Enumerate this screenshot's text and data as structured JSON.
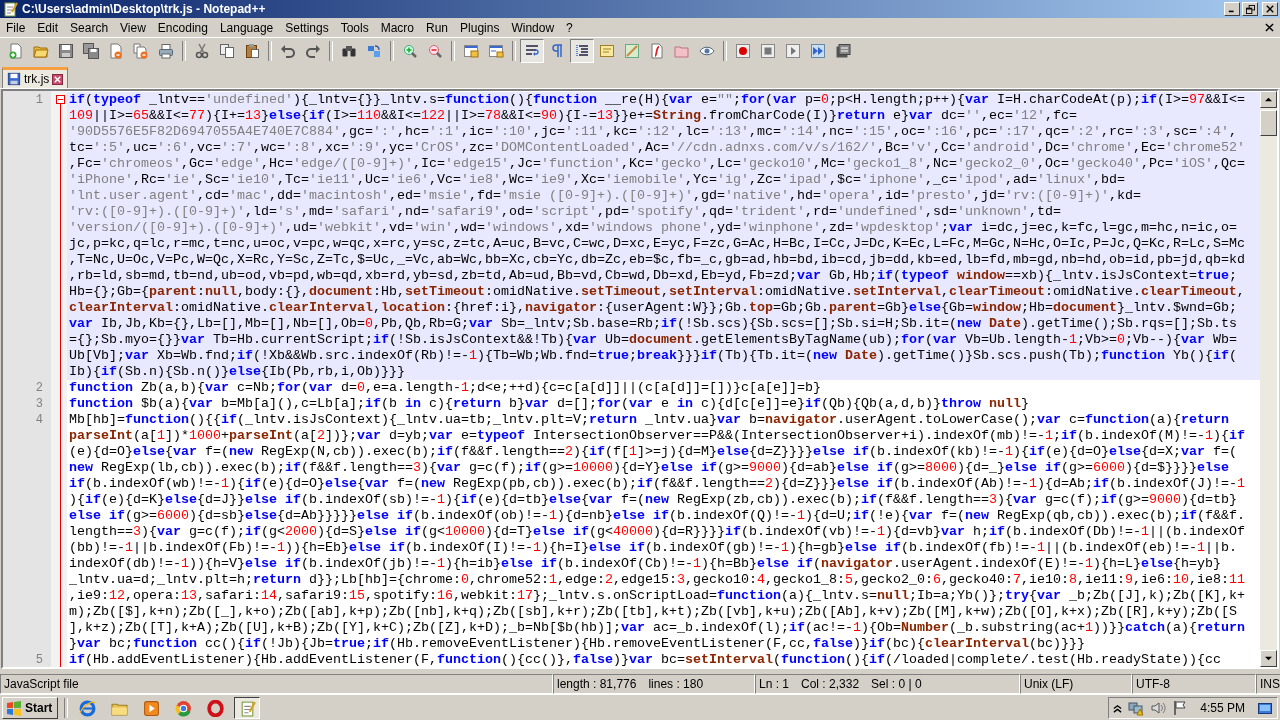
{
  "window": {
    "title": "C:\\Users\\admin\\Desktop\\trk.js - Notepad++"
  },
  "menu": [
    "File",
    "Edit",
    "Search",
    "View",
    "Encoding",
    "Language",
    "Settings",
    "Tools",
    "Macro",
    "Run",
    "Plugins",
    "Window",
    "?"
  ],
  "toolbar": {
    "word_wrap": true,
    "show_all_characters": false,
    "indent_guide": true
  },
  "tabs": [
    {
      "label": "trk.js",
      "selected": true
    }
  ],
  "editor": {
    "lines": [
      {
        "number": "1",
        "current": true,
        "foldable": true,
        "rows": [
          "if(typeof _lntv=='undefined'){_lntv={}}_lntv.s=function(){function __re(H){var e=\"\";for(var p=0;p<H.length;p++){var I=H.charCodeAt(p);if(I>=97&&I<=",
          "109||I>=65&&I<=77){I+=13}else{if(I>=110&&I<=122||I>=78&&I<=90){I-=13}}e+=String.fromCharCode(I)}return e}var dc='',ec='12',fc=",
          "'90D5576E5F82D6947055A4E740E7C884',gc=':',hc=':1',ic=':10',jc=':11',kc=':12',lc=':13',mc=':14',nc=':15',oc=':16',pc=':17',qc=':2',rc=':3',sc=':4',",
          "tc=':5',uc=':6',vc=':7',wc=':8',xc=':9',yc='CrOS',zc='DOMContentLoaded',Ac='//cdn.adnxs.com/v/s/162/',Bc='v',Cc='android',Dc='chrome',Ec='chrome52'",
          ",Fc='chromeos',Gc='edge',Hc='edge/([0-9]+)',Ic='edge15',Jc='function',Kc='gecko',Lc='gecko10',Mc='gecko1_8',Nc='gecko2_0',Oc='gecko40',Pc='iOS',Qc=",
          "'iPhone',Rc='ie',Sc='ie10',Tc='ie11',Uc='ie6',Vc='ie8',Wc='ie9',Xc='iemobile',Yc='ig',Zc='ipad',$c='iphone',_c='ipod',ad='linux',bd=",
          "'lnt.user.agent',cd='mac',dd='macintosh',ed='msie',fd='msie ([0-9]+).([0-9]+)',gd='native',hd='opera',id='presto',jd='rv:([0-9]+)',kd=",
          "'rv:([0-9]+).([0-9]+)',ld='s',md='safari',nd='safari9',od='script',pd='spotify',qd='trident',rd='undefined',sd='unknown',td=",
          "'version/([0-9]+).([0-9]+)',ud='webkit',vd='win',wd='windows',xd='windows phone',yd='winphone',zd='wpdesktop';var i=dc,j=ec,k=fc,l=gc,m=hc,n=ic,o=",
          "jc,p=kc,q=lc,r=mc,t=nc,u=oc,v=pc,w=qc,x=rc,y=sc,z=tc,A=uc,B=vc,C=wc,D=xc,E=yc,F=zc,G=Ac,H=Bc,I=Cc,J=Dc,K=Ec,L=Fc,M=Gc,N=Hc,O=Ic,P=Jc,Q=Kc,R=Lc,S=Mc",
          ",T=Nc,U=Oc,V=Pc,W=Qc,X=Rc,Y=Sc,Z=Tc,$=Uc,_=Vc,ab=Wc,bb=Xc,cb=Yc,db=Zc,eb=$c,fb=_c,gb=ad,hb=bd,ib=cd,jb=dd,kb=ed,lb=fd,mb=gd,nb=hd,ob=id,pb=jd,qb=kd",
          ",rb=ld,sb=md,tb=nd,ub=od,vb=pd,wb=qd,xb=rd,yb=sd,zb=td,Ab=ud,Bb=vd,Cb=wd,Db=xd,Eb=yd,Fb=zd;var Gb,Hb;if(typeof window==xb){_lntv.isJsContext=true;",
          "Hb={};Gb={parent:null,body:{},document:Hb,setTimeout:omidNative.setTimeout,setInterval:omidNative.setInterval,clearTimeout:omidNative.clearTimeout,",
          "clearInterval:omidNative.clearInterval,location:{href:i},navigator:{userAgent:W}};Gb.top=Gb;Gb.parent=Gb}else{Gb=window;Hb=document}_lntv.$wnd=Gb;",
          "var Ib,Jb,Kb={},Lb=[],Mb=[],Nb=[],Ob=0,Pb,Qb,Rb=G;var Sb=_lntv;Sb.base=Rb;if(!Sb.scs){Sb.scs=[];Sb.si=H;Sb.it=(new Date).getTime();Sb.rqs=[];Sb.ts",
          "={};Sb.myo={}}var Tb=Hb.currentScript;if(!Sb.isJsContext&&!Tb){var Ub=document.getElementsByTagName(ub);for(var Vb=Ub.length-1;Vb>=0;Vb--){var Wb=",
          "Ub[Vb];var Xb=Wb.fnd;if(!Xb&&Wb.src.indexOf(Rb)!=-1){Tb=Wb;Wb.fnd=true;break}}}if(Tb){Tb.it=(new Date).getTime()}Sb.scs.push(Tb);function Yb(){if(",
          "Ib){if(Sb.n){Sb.n()}else{Ib(Pb,rb,i,Ob)}}}"
        ]
      },
      {
        "number": "2",
        "current": false,
        "foldable": false,
        "rows": [
          "function Zb(a,b){var c=Nb;for(var d=0,e=a.length-1;d<e;++d){c=c[a[d]]||(c[a[d]]=[])}c[a[e]]=b}"
        ]
      },
      {
        "number": "3",
        "current": false,
        "foldable": false,
        "rows": [
          "function $b(a){var b=Mb[a](),c=Lb[a];if(b in c){return b}var d=[];for(var e in c){d[c[e]]=e}if(Qb){Qb(a,d,b)}throw null}"
        ]
      },
      {
        "number": "4",
        "current": false,
        "foldable": false,
        "rows": [
          "Mb[hb]=function(){{if(_lntv.isJsContext){_lntv.ua=tb;_lntv.plt=V;return _lntv.ua}var b=navigator.userAgent.toLowerCase();var c=function(a){return",
          "parseInt(a[1])*1000+parseInt(a[2])};var d=yb;var e=typeof IntersectionObserver==P&&(IntersectionObserver+i).indexOf(mb)!=-1;if(b.indexOf(M)!=-1){if",
          "(e){d=O}else{var f=(new RegExp(N,cb)).exec(b);if(f&&f.length==2){if(f[1]>=j){d=M}else{d=Z}}}}else if(b.indexOf(kb)!=-1){if(e){d=O}else{d=X;var f=(",
          "new RegExp(lb,cb)).exec(b);if(f&&f.length==3){var g=c(f);if(g>=10000){d=Y}else if(g>=9000){d=ab}else if(g>=8000){d=_}else if(g>=6000){d=$}}}}else",
          "if(b.indexOf(wb)!=-1){if(e){d=O}else{var f=(new RegExp(pb,cb)).exec(b);if(f&&f.length==2){d=Z}}}else if(b.indexOf(Ab)!=-1){d=Ab;if(b.indexOf(J)!=-1",
          "){if(e){d=K}else{d=J}}else if(b.indexOf(sb)!=-1){if(e){d=tb}else{var f=(new RegExp(zb,cb)).exec(b);if(f&&f.length==3){var g=c(f);if(g>=9000){d=tb}",
          "else if(g>=6000){d=sb}else{d=Ab}}}}}else if(b.indexOf(ob)!=-1){d=nb}else if(b.indexOf(Q)!=-1){d=U;if(!e){var f=(new RegExp(qb,cb)).exec(b);if(f&&f.",
          "length==3){var g=c(f);if(g<2000){d=S}else if(g<10000){d=T}else if(g<40000){d=R}}}}if(b.indexOf(vb)!=-1){d=vb}var h;if(b.indexOf(Db)!=-1||(b.indexOf",
          "(bb)!=-1||b.indexOf(Fb)!=-1)){h=Eb}else if(b.indexOf(I)!=-1){h=I}else if(b.indexOf(gb)!=-1){h=gb}else if(b.indexOf(fb)!=-1||(b.indexOf(eb)!=-1||b.",
          "indexOf(db)!=-1)){h=V}else if(b.indexOf(jb)!=-1){h=ib}else if(b.indexOf(Cb)!=-1){h=Bb}else if(navigator.userAgent.indexOf(E)!=-1){h=L}else{h=yb}",
          "_lntv.ua=d;_lntv.plt=h;return d}};Lb[hb]={chrome:0,chrome52:1,edge:2,edge15:3,gecko10:4,gecko1_8:5,gecko2_0:6,gecko40:7,ie10:8,ie11:9,ie6:10,ie8:11",
          ",ie9:12,opera:13,safari:14,safari9:15,spotify:16,webkit:17};_lntv.s.onScriptLoad=function(a){_lntv.s=null;Ib=a;Yb()};try{var _b;Zb([J],k);Zb([K],k+",
          "m);Zb([$],k+n);Zb([_],k+o);Zb([ab],k+p);Zb([nb],k+q);Zb([sb],k+r);Zb([tb],k+t);Zb([vb],k+u);Zb([Ab],k+v);Zb([M],k+w);Zb([O],k+x);Zb([R],k+y);Zb([S",
          "],k+z);Zb([T],k+A);Zb([U],k+B);Zb([Y],k+C);Zb([Z],k+D);_b=Nb[$b(hb)];var ac=_b.indexOf(l);if(ac!=-1){Ob=Number(_b.substring(ac+1))}}catch(a){return",
          "}var bc;function cc(){if(!Jb){Jb=true;if(Hb.removeEventListener){Hb.removeEventListener(F,cc,false)}if(bc){clearInterval(bc)}}}"
        ]
      },
      {
        "number": "5",
        "current": false,
        "foldable": false,
        "rows": [
          "if(Hb.addEventListener){Hb.addEventListener(F,function(){cc()},false)}var bc=setInterval(function(){if(/loaded|complete/.test(Hb.readyState)){cc"
        ]
      }
    ]
  },
  "status_bar": {
    "file_type": "JavaScript file",
    "length": "length : 81,776",
    "lines": "lines : 180",
    "ln": "Ln : 1",
    "col": "Col : 2,332",
    "sel": "Sel : 0 | 0",
    "eol": "Unix (LF)",
    "encoding": "UTF-8",
    "mode": "INS"
  },
  "taskbar": {
    "start": "Start",
    "apps": [
      {
        "selected": false
      },
      {
        "selected": false
      },
      {
        "selected": false
      },
      {
        "selected": false
      },
      {
        "selected": false
      },
      {
        "selected": true
      }
    ],
    "clock": "4:55 PM"
  }
}
